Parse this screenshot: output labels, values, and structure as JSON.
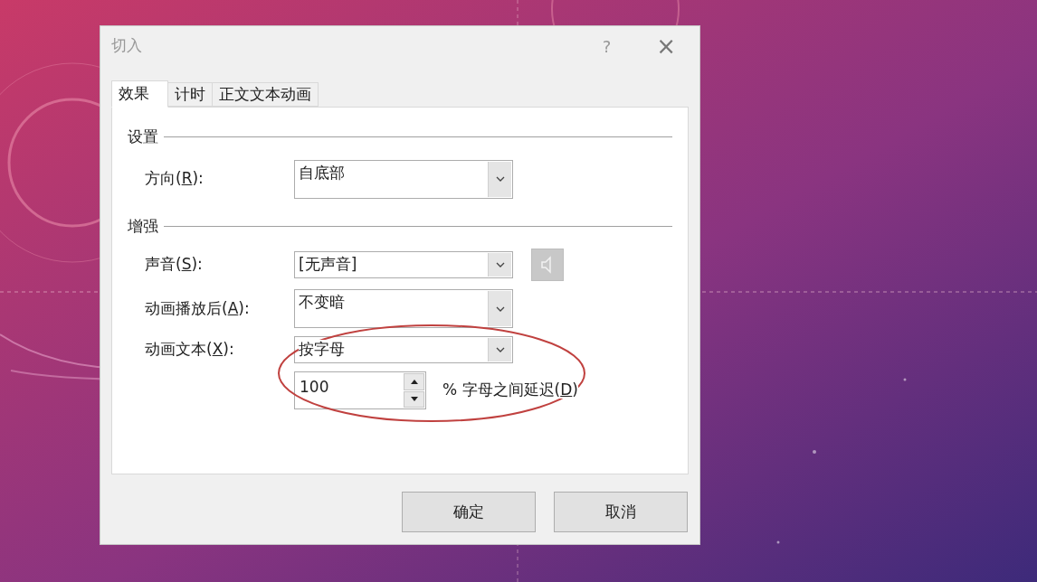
{
  "window": {
    "title": "切入",
    "help": "?",
    "close": "×"
  },
  "tabs": [
    {
      "label": "效果",
      "selected": true
    },
    {
      "label": "计时",
      "selected": false
    },
    {
      "label": "正文文本动画",
      "selected": false
    }
  ],
  "groups": [
    {
      "title": "设置",
      "rows": [
        {
          "kind": "combo_tall",
          "label_parts": [
            "方向(",
            "R",
            "):"
          ],
          "value": "自底部"
        }
      ]
    },
    {
      "title": "增强",
      "rows": [
        {
          "kind": "combo_sound",
          "label_parts": [
            "声音(",
            "S",
            "):"
          ],
          "value": "[无声音]"
        },
        {
          "kind": "combo_tall",
          "label_parts": [
            "动画播放后(",
            "A",
            "):"
          ],
          "value": "不变暗"
        },
        {
          "kind": "combo",
          "label_parts": [
            "动画文本(",
            "X",
            "):"
          ],
          "value": "按字母"
        },
        {
          "kind": "spinner",
          "value": "100",
          "suffix_parts": [
            "% 字母之间延迟(",
            "D",
            ")"
          ]
        }
      ]
    }
  ],
  "buttons": [
    "确定",
    "取消"
  ]
}
